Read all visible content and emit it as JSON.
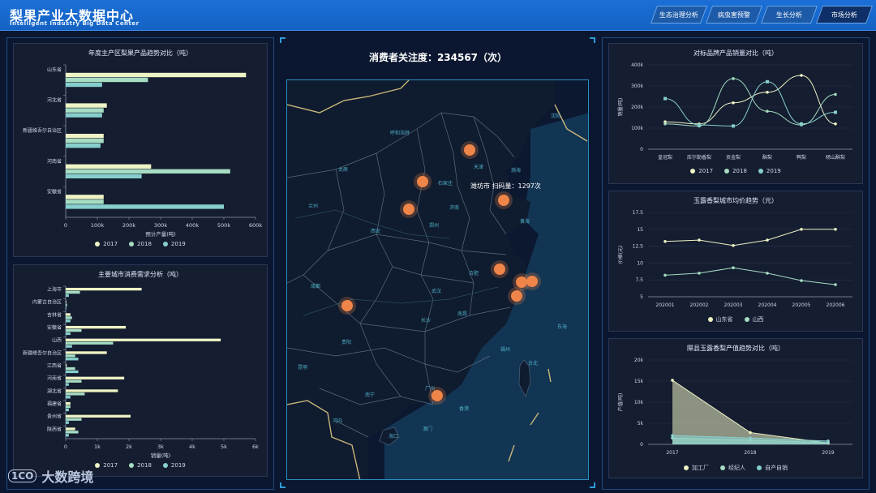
{
  "header": {
    "title": "梨果产业大数据中心",
    "subtitle": "Intelligent Industry Big Data Center",
    "tabs": [
      "生态治理分析",
      "病虫害预警",
      "生长分析",
      "市场分析"
    ],
    "active_tab": "市场分析"
  },
  "colors": {
    "s2017": "#eef3c5",
    "s2018": "#a6ddc3",
    "s2019": "#87cfcd",
    "accent": "#ef8548"
  },
  "map": {
    "attention_label": "消费者关注度：234567（次）",
    "tooltip": "潍坊市 扫码量：1297次",
    "place_labels": [
      "呼和浩特",
      "沈阳",
      "太原",
      "石家庄",
      "天津",
      "渤海",
      "潍坊市",
      "济南",
      "兰州",
      "西安",
      "郑州",
      "黄海",
      "合肥",
      "成都",
      "武汉",
      "南昌",
      "长沙",
      "东海",
      "贵阳",
      "昆明",
      "福州",
      "台北",
      "南宁",
      "广州",
      "香港",
      "澳门",
      "海口",
      "河内"
    ]
  },
  "chart_data": [
    {
      "type": "bar",
      "title": "年度主产区梨果产品趋势对比（吨）",
      "xlabel": "预计产量(吨)",
      "orientation": "horizontal",
      "categories": [
        "山东省",
        "河北省",
        "新疆维吾尔自治区",
        "河南省",
        "安徽省"
      ],
      "series": [
        {
          "name": "2017",
          "values": [
            570000,
            130000,
            120000,
            270000,
            120000
          ]
        },
        {
          "name": "2018",
          "values": [
            260000,
            120000,
            120000,
            520000,
            120000
          ]
        },
        {
          "name": "2019",
          "values": [
            115000,
            115000,
            110000,
            240000,
            500000
          ]
        }
      ],
      "xlim": [
        0,
        600000
      ],
      "xticks": [
        "0",
        "100k",
        "200k",
        "300k",
        "400k",
        "500k",
        "600k"
      ],
      "legend": "bottom"
    },
    {
      "type": "bar",
      "title": "主要城市消费需求分析（吨）",
      "xlabel": "销量(吨)",
      "orientation": "horizontal",
      "categories": [
        "上海市",
        "内蒙古自治区",
        "吉林省",
        "安徽省",
        "山西",
        "新疆维吾尔自治区",
        "江西省",
        "河南省",
        "湖北省",
        "福建省",
        "贵州省",
        "陕西省"
      ],
      "series": [
        {
          "name": "2017",
          "values": [
            2400,
            20,
            150,
            1900,
            4900,
            1300,
            30,
            1850,
            1650,
            150,
            2050,
            300
          ]
        },
        {
          "name": "2018",
          "values": [
            450,
            40,
            200,
            500,
            1500,
            300,
            300,
            500,
            600,
            150,
            500,
            400
          ]
        },
        {
          "name": "2019",
          "values": [
            100,
            20,
            150,
            150,
            200,
            400,
            400,
            100,
            150,
            100,
            100,
            100
          ]
        }
      ],
      "xlim": [
        0,
        6000
      ],
      "xticks": [
        "0",
        "1k",
        "2k",
        "3k",
        "4k",
        "5k",
        "6k"
      ],
      "legend": "bottom"
    },
    {
      "type": "line",
      "title": "对标品牌产品销量对比（吨）",
      "ylabel": "销量(吨)",
      "categories": [
        "皇冠梨",
        "库尔勒香梨",
        "贡金梨",
        "酥梨",
        "鸭梨",
        "砀山酥梨"
      ],
      "series": [
        {
          "name": "2017",
          "values": [
            130000,
            120000,
            220000,
            270000,
            350000,
            120000
          ]
        },
        {
          "name": "2018",
          "values": [
            120000,
            110000,
            335000,
            180000,
            115000,
            260000
          ]
        },
        {
          "name": "2019",
          "values": [
            240000,
            115000,
            110000,
            320000,
            120000,
            175000
          ]
        }
      ],
      "ylim": [
        0,
        400000
      ],
      "yticks": [
        "0",
        "100k",
        "200k",
        "300k",
        "400k"
      ],
      "legend": "bottom"
    },
    {
      "type": "line",
      "title": "玉露香梨城市均价趋势（元）",
      "ylabel": "价格(元)",
      "categories": [
        "202001",
        "202002",
        "202003",
        "202004",
        "202005",
        "202006"
      ],
      "series": [
        {
          "name": "山东省",
          "values": [
            13.2,
            13.4,
            12.6,
            13.4,
            15.0,
            15.0
          ]
        },
        {
          "name": "山西",
          "values": [
            8.2,
            8.5,
            9.3,
            8.5,
            7.4,
            6.8
          ]
        }
      ],
      "ylim": [
        5,
        17.5
      ],
      "yticks": [
        "5",
        "7.5",
        "10",
        "12.5",
        "15",
        "17.5"
      ],
      "legend": "bottom"
    },
    {
      "type": "area",
      "title": "隰县玉露香梨产值趋势对比（吨）",
      "ylabel": "产值(吨)",
      "categories": [
        "2017",
        "2018",
        "2019"
      ],
      "series": [
        {
          "name": "加工厂",
          "values": [
            15200,
            2800,
            300
          ]
        },
        {
          "name": "经纪人",
          "values": [
            1500,
            1000,
            400
          ]
        },
        {
          "name": "自产自销",
          "values": [
            2100,
            1500,
            800
          ]
        }
      ],
      "ylim": [
        0,
        20000
      ],
      "yticks": [
        "0",
        "5k",
        "10k",
        "15k",
        "20k"
      ],
      "legend": "bottom"
    }
  ],
  "logo": {
    "mark": "1CO",
    "text": "大数跨境"
  }
}
